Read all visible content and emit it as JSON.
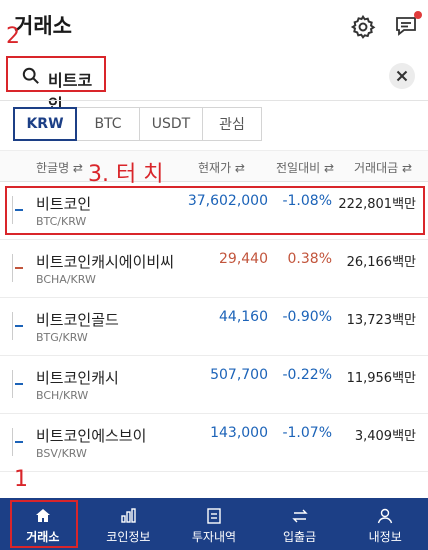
{
  "header": {
    "title": "거래소"
  },
  "annotations": {
    "step2": "2",
    "step3": "3. 터 치",
    "step1": "1"
  },
  "search": {
    "query": "비트코인"
  },
  "tabs": [
    {
      "label": "KRW",
      "active": true
    },
    {
      "label": "BTC",
      "active": false
    },
    {
      "label": "USDT",
      "active": false
    },
    {
      "label": "관심",
      "active": false
    }
  ],
  "columns": {
    "name": "한글명 ⇄",
    "price": "현재가 ⇄",
    "change": "전일대비 ⇄",
    "volume": "거래대금 ⇄"
  },
  "rows": [
    {
      "name": "비트코인",
      "pair": "BTC/KRW",
      "price": "37,602,000",
      "change": "-1.08%",
      "volume": "222,801백만",
      "trend": "down"
    },
    {
      "name": "비트코인캐시에이비씨",
      "pair": "BCHA/KRW",
      "price": "29,440",
      "change": "0.38%",
      "volume": "26,166백만",
      "trend": "up"
    },
    {
      "name": "비트코인골드",
      "pair": "BTG/KRW",
      "price": "44,160",
      "change": "-0.90%",
      "volume": "13,723백만",
      "trend": "down"
    },
    {
      "name": "비트코인캐시",
      "pair": "BCH/KRW",
      "price": "507,700",
      "change": "-0.22%",
      "volume": "11,956백만",
      "trend": "down"
    },
    {
      "name": "비트코인에스브이",
      "pair": "BSV/KRW",
      "price": "143,000",
      "change": "-1.07%",
      "volume": "3,409백만",
      "trend": "down"
    }
  ],
  "bottom_nav": [
    {
      "label": "거래소",
      "icon": "home-icon",
      "active": true
    },
    {
      "label": "코인정보",
      "icon": "bar-chart-icon",
      "active": false
    },
    {
      "label": "투자내역",
      "icon": "document-icon",
      "active": false
    },
    {
      "label": "입출금",
      "icon": "transfer-icon",
      "active": false
    },
    {
      "label": "내정보",
      "icon": "user-icon",
      "active": false
    }
  ],
  "colors": {
    "accent": "#1c3f86",
    "down": "#1c63b8",
    "up": "#c2553c",
    "annotation": "#d9252a"
  }
}
